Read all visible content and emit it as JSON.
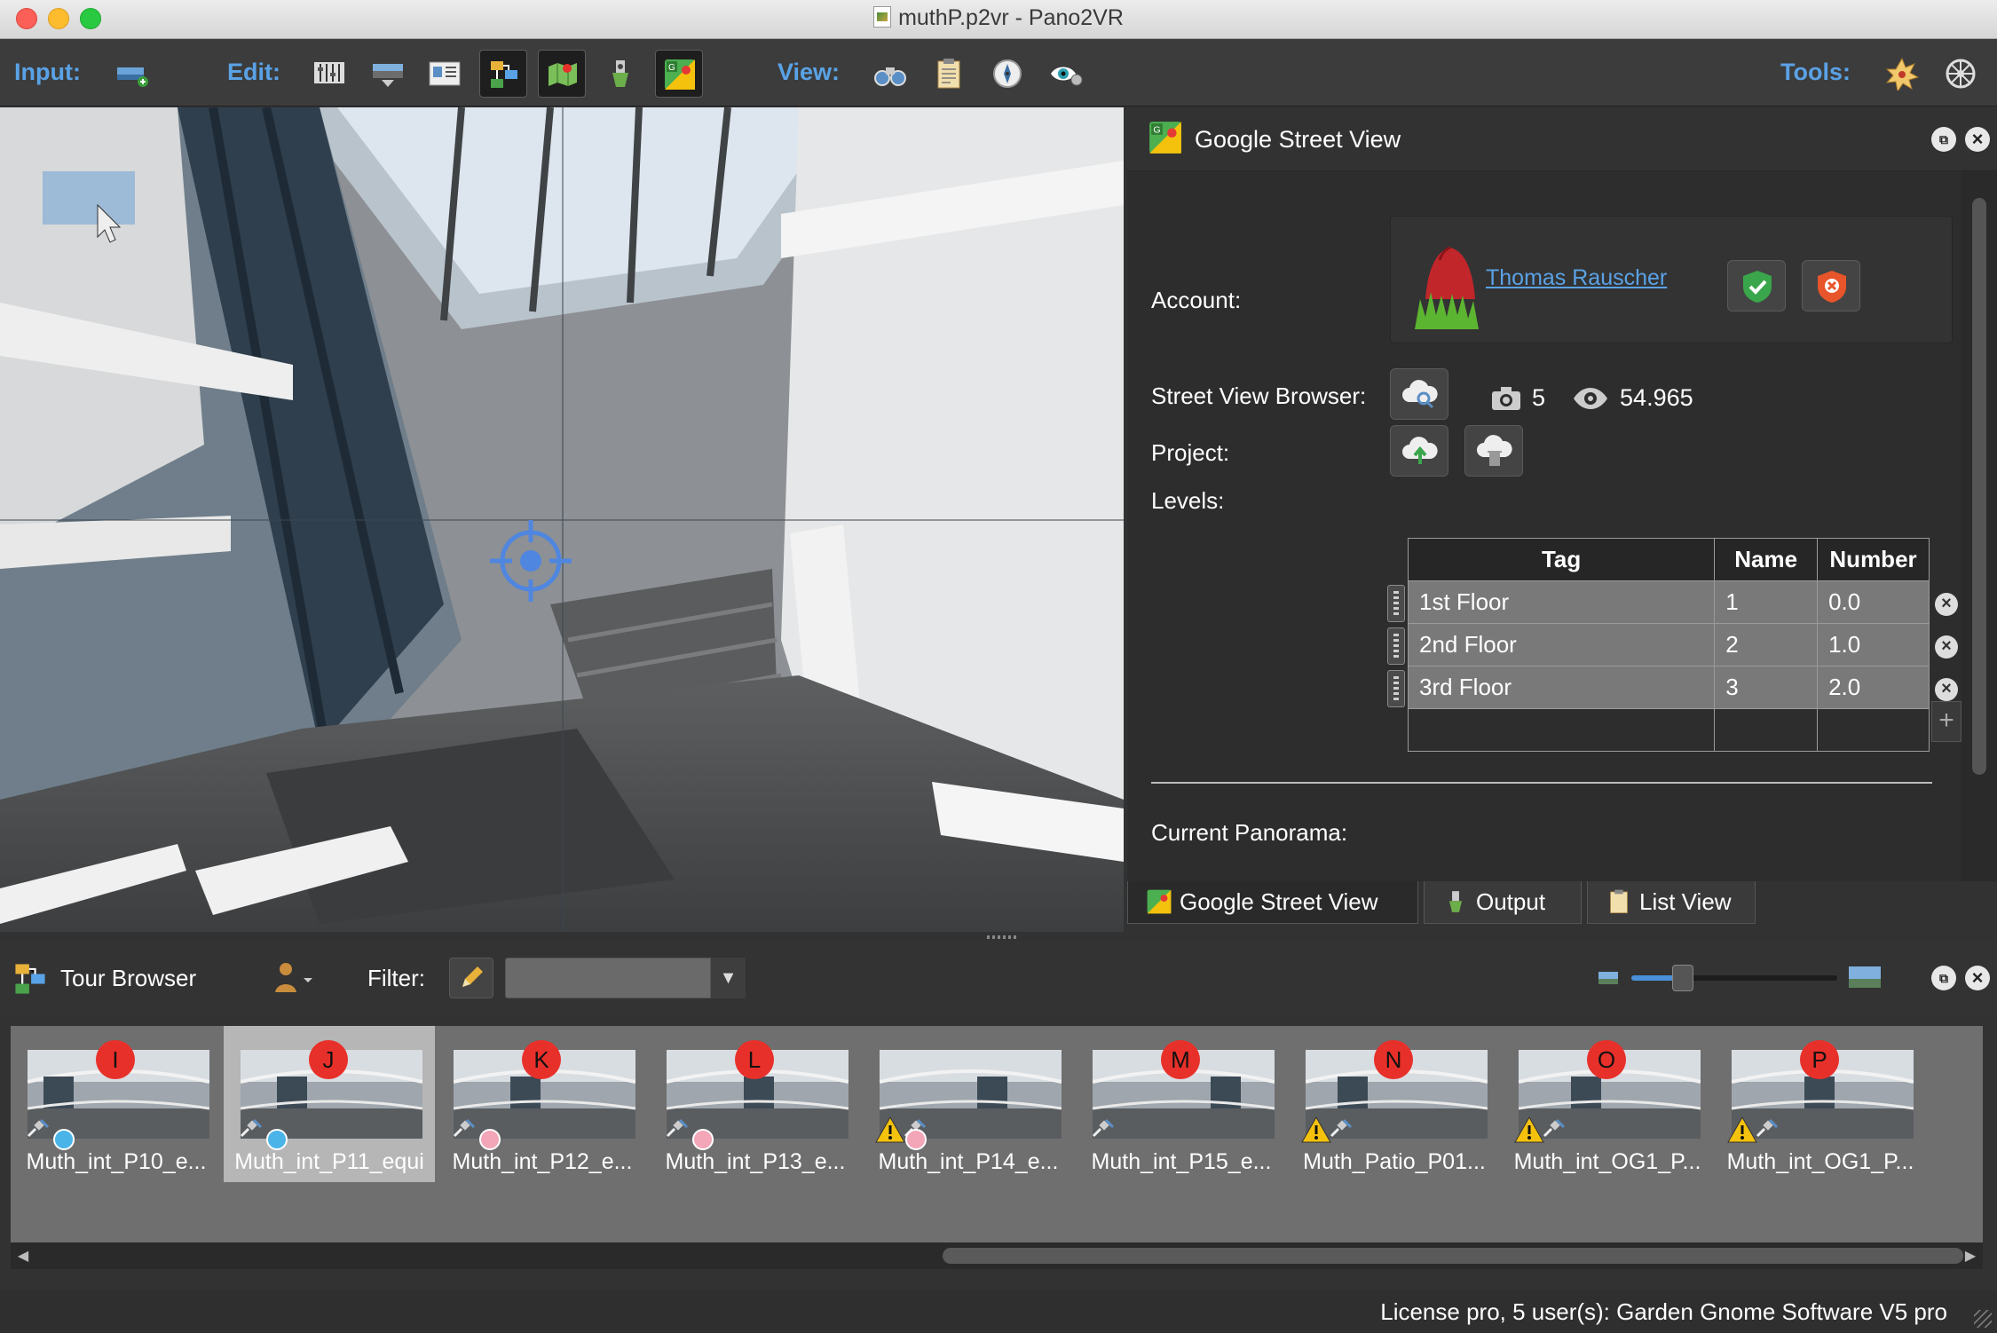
{
  "window": {
    "title": "muthP.p2vr - Pano2VR"
  },
  "toolbar": {
    "input_label": "Input:",
    "edit_label": "Edit:",
    "view_label": "View:",
    "tools_label": "Tools:",
    "input_icons": [
      "add-panorama-icon"
    ],
    "edit_icons": [
      "viewing-parameters-icon",
      "patch-icon",
      "properties-icon",
      "tour-browser-icon",
      "tour-map-icon",
      "animation-icon",
      "google-street-view-icon"
    ],
    "view_icons": [
      "binoculars-icon",
      "clipboard-icon",
      "compass-icon",
      "eye-gear-icon"
    ],
    "tools_icons": [
      "tools-burst-icon",
      "wheel-gear-icon"
    ]
  },
  "gsv_panel": {
    "title": "Google Street View",
    "account_label": "Account:",
    "account_name": "Thomas Rauscher",
    "browser_label": "Street View Browser:",
    "photo_count": "5",
    "view_count": "54.965",
    "project_label": "Project:",
    "levels_label": "Levels:",
    "levels_columns": [
      "Tag",
      "Name",
      "Number"
    ],
    "levels_rows": [
      {
        "tag": "1st Floor",
        "name": "1",
        "number": "0.0"
      },
      {
        "tag": "2nd Floor",
        "name": "2",
        "number": "1.0"
      },
      {
        "tag": "3rd Floor",
        "name": "3",
        "number": "2.0"
      }
    ],
    "current_panorama_label": "Current Panorama:",
    "tabs": [
      "Google Street View",
      "Output",
      "List View"
    ],
    "colors": {
      "accent": "#5aa2e6",
      "shield_green": "#3aa64b",
      "shield_orange": "#e8552b"
    }
  },
  "tour_browser": {
    "title": "Tour Browser",
    "filter_label": "Filter:",
    "filter_value": "",
    "zoom_level": 0.25,
    "thumbnails": [
      {
        "label": "Muth_int_P10_e...",
        "pin": "I",
        "status": "blue",
        "warning": false,
        "selected": false
      },
      {
        "label": "Muth_int_P11_equi",
        "pin": "J",
        "status": "blue",
        "warning": false,
        "selected": true
      },
      {
        "label": "Muth_int_P12_e...",
        "pin": "K",
        "status": "pink",
        "warning": false,
        "selected": false
      },
      {
        "label": "Muth_int_P13_e...",
        "pin": "L",
        "status": "pink",
        "warning": false,
        "selected": false
      },
      {
        "label": "Muth_int_P14_e...",
        "pin": "",
        "status": "pink",
        "warning": true,
        "selected": false
      },
      {
        "label": "Muth_int_P15_e...",
        "pin": "M",
        "status": "",
        "warning": false,
        "selected": false
      },
      {
        "label": "Muth_Patio_P01...",
        "pin": "N",
        "status": "",
        "warning": true,
        "selected": false
      },
      {
        "label": "Muth_int_OG1_P...",
        "pin": "O",
        "status": "",
        "warning": true,
        "selected": false
      },
      {
        "label": "Muth_int_OG1_P...",
        "pin": "P",
        "status": "",
        "warning": true,
        "selected": false
      }
    ]
  },
  "status_bar": {
    "text": "License pro, 5 user(s): Garden Gnome Software V5 pro"
  }
}
